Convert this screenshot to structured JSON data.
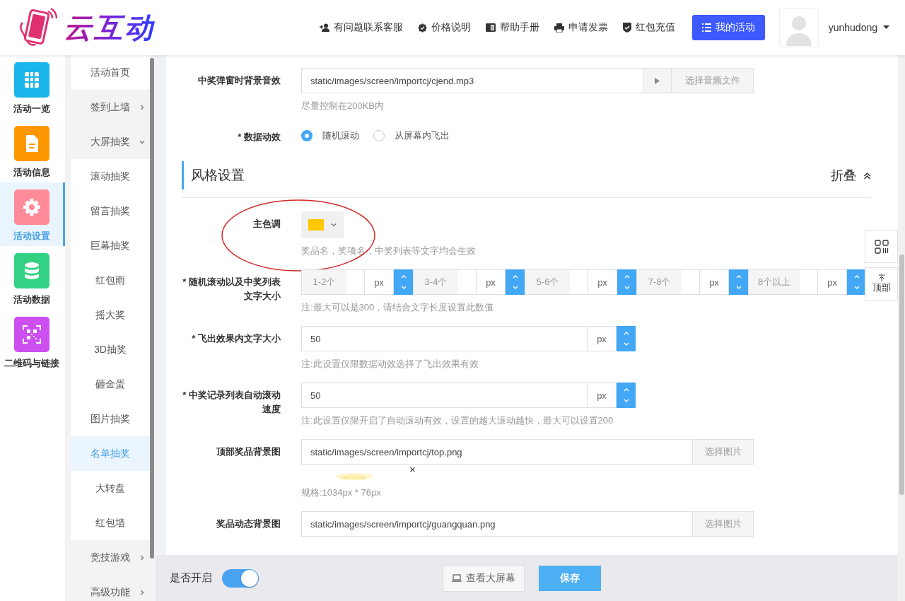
{
  "header": {
    "logo_text": "云互动",
    "links": [
      {
        "label": "有问题联系客服"
      },
      {
        "label": "价格说明"
      },
      {
        "label": "帮助手册"
      },
      {
        "label": "申请发票"
      },
      {
        "label": "红包充值"
      }
    ],
    "primary_button": "我的活动",
    "user": {
      "name": "yunhudong"
    }
  },
  "sidebar": {
    "items": [
      {
        "label": "活动一览",
        "color": "#1ab5ea",
        "selected": false
      },
      {
        "label": "活动信息",
        "color": "#ff9800",
        "selected": false
      },
      {
        "label": "活动设置",
        "color": "#ff8a98",
        "selected": true
      },
      {
        "label": "活动数据",
        "color": "#33d183",
        "selected": false
      },
      {
        "label": "二维码与链接",
        "color": "#cc4ff0",
        "selected": false
      }
    ]
  },
  "subnav": {
    "items": [
      {
        "label": "活动首页",
        "selected": false
      },
      {
        "label": "签到上墙",
        "selected": false,
        "expanded": false
      },
      {
        "label": "大屏抽奖",
        "selected": false,
        "expanded": true,
        "children": [
          {
            "label": "滚动抽奖",
            "selected": false
          },
          {
            "label": "留言抽奖",
            "selected": false
          },
          {
            "label": "巨幕抽奖",
            "selected": false
          },
          {
            "label": "红包雨",
            "selected": false
          },
          {
            "label": "摇大奖",
            "selected": false
          },
          {
            "label": "3D抽奖",
            "selected": false
          },
          {
            "label": "砸金蛋",
            "selected": false
          },
          {
            "label": "图片抽奖",
            "selected": false
          },
          {
            "label": "名单抽奖",
            "selected": true
          },
          {
            "label": "大转盘",
            "selected": false
          },
          {
            "label": "红包墙",
            "selected": false
          }
        ]
      },
      {
        "label": "竞技游戏",
        "selected": false,
        "expanded": false
      },
      {
        "label": "高级功能",
        "selected": false,
        "expanded": false
      }
    ]
  },
  "form": {
    "rows": [
      {
        "kind": "file",
        "label": "中奖弹窗时背景音效",
        "value": "static/images/screen/importcj/cjend.mp3",
        "button": "选择音频文件",
        "hint": "尽量控制在200KB内"
      },
      {
        "kind": "radio",
        "label": "* 数据动效",
        "options": [
          {
            "label": "随机滚动",
            "selected": true
          },
          {
            "label": "从屏幕内飞出",
            "selected": false
          }
        ]
      },
      {
        "kind": "section",
        "title": "风格设置",
        "action": "折叠"
      },
      {
        "kind": "color",
        "label": "主色调",
        "color": "#ffc800",
        "circled": true,
        "hint": "奖品名，奖项名，中奖列表等文字均会生效"
      },
      {
        "kind": "size_group",
        "label": "* 随机滚动以及中奖列表文字大小",
        "groups": [
          {
            "prefix": "1-2个",
            "unit": "px"
          },
          {
            "prefix": "3-4个",
            "unit": "px"
          },
          {
            "prefix": "5-6个",
            "unit": "px"
          },
          {
            "prefix": "7-8个",
            "unit": "px"
          },
          {
            "prefix": "8个以上",
            "unit": "px"
          }
        ],
        "hint": "注:最大可以是300，请结合文字长度设置此数值"
      },
      {
        "kind": "number",
        "label": "* 飞出效果内文字大小",
        "value": "50",
        "unit": "px",
        "hint": "注:此设置仅限数据动效选择了飞出效果有效"
      },
      {
        "kind": "number",
        "label": "* 中奖记录列表自动滚动速度",
        "value": "50",
        "unit": "px",
        "hint": "注:此设置仅限开启了自动滚动有效，设置的越大滚动越快，最大可以设置200"
      },
      {
        "label": "顶部奖品背景图",
        "value": "static/images/screen/importcj/top.png",
        "button": "选择图片",
        "remove": "×",
        "hint": "规格:1034px * 76px"
      },
      {
        "label": "奖品动态背景图",
        "value": "static/images/screen/importcj/guangquan.png",
        "button": "选择图片"
      }
    ]
  },
  "float_tools": {
    "top_label": "顶部"
  },
  "bottom_bar": {
    "toggle_label": "是否开启",
    "toggle_on": true,
    "preview_button": "查看大屏幕",
    "save_button": "保存"
  }
}
